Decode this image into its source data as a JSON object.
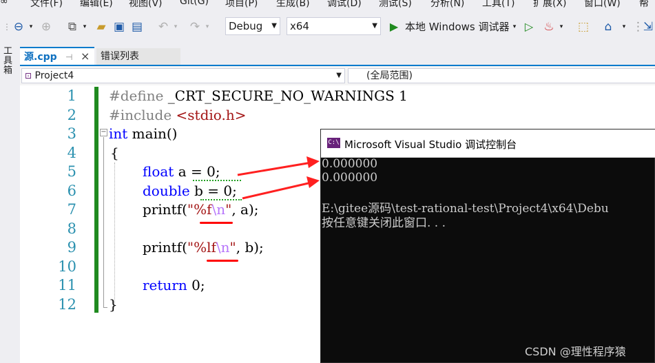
{
  "menu": [
    "文件(F)",
    "编辑(E)",
    "视图(V)",
    "Git(G)",
    "项目(P)",
    "生成(B)",
    "调试(D)",
    "测试(S)",
    "分析(N)",
    "工具(T)",
    "扩展(X)",
    "窗口(W)",
    "帮"
  ],
  "toolbar": {
    "config": "Debug",
    "platform": "x64",
    "run_label": "本地 Windows 调试器"
  },
  "toolbox_label": "工具箱",
  "tabs": [
    {
      "label": "源.cpp",
      "pin": "⊣",
      "close": "×"
    },
    {
      "label": "错误列表"
    }
  ],
  "nav": {
    "project": "Project4",
    "scope": "(全局范围)"
  },
  "editor": {
    "line_numbers": [
      "1",
      "2",
      "3",
      "4",
      "5",
      "6",
      "7",
      "8",
      "9",
      "10",
      "11",
      "12"
    ],
    "lines": {
      "l1_pp": "#define",
      "l1_rest": " _CRT_SECURE_NO_WARNINGS 1",
      "l2_pp": "#include",
      "l2_hdr": " <stdio.h>",
      "l3_kw": "int",
      "l3_rest": " main()",
      "l4": "{",
      "l5_kw": "float",
      "l5_rest": " a = 0;",
      "l6_kw": "double",
      "l6_rest": " b = 0;",
      "l7_a": "printf(",
      "l7_str": "\"%f",
      "l7_esc": "\\n",
      "l7_q": "\"",
      "l7_b": ", a);",
      "l9_a": "printf(",
      "l9_str": "\"%lf",
      "l9_esc": "\\n",
      "l9_q": "\"",
      "l9_b": ", b);",
      "l11_kw": "return",
      "l11_rest": " 0;",
      "l12": "}"
    }
  },
  "console": {
    "icon_text": "C:\\",
    "title": "Microsoft Visual Studio 调试控制台",
    "lines": [
      "0.000000",
      "0.000000",
      "",
      "E:\\gitee源码\\test-rational-test\\Project4\\x64\\Debu",
      "按任意键关闭此窗口. . ."
    ]
  },
  "watermark": "CSDN @理性程序猿",
  "colors": {
    "annotation": "#ff0000",
    "console_bg": "#0c0c0c",
    "change_bar": "#1f8a1f"
  }
}
